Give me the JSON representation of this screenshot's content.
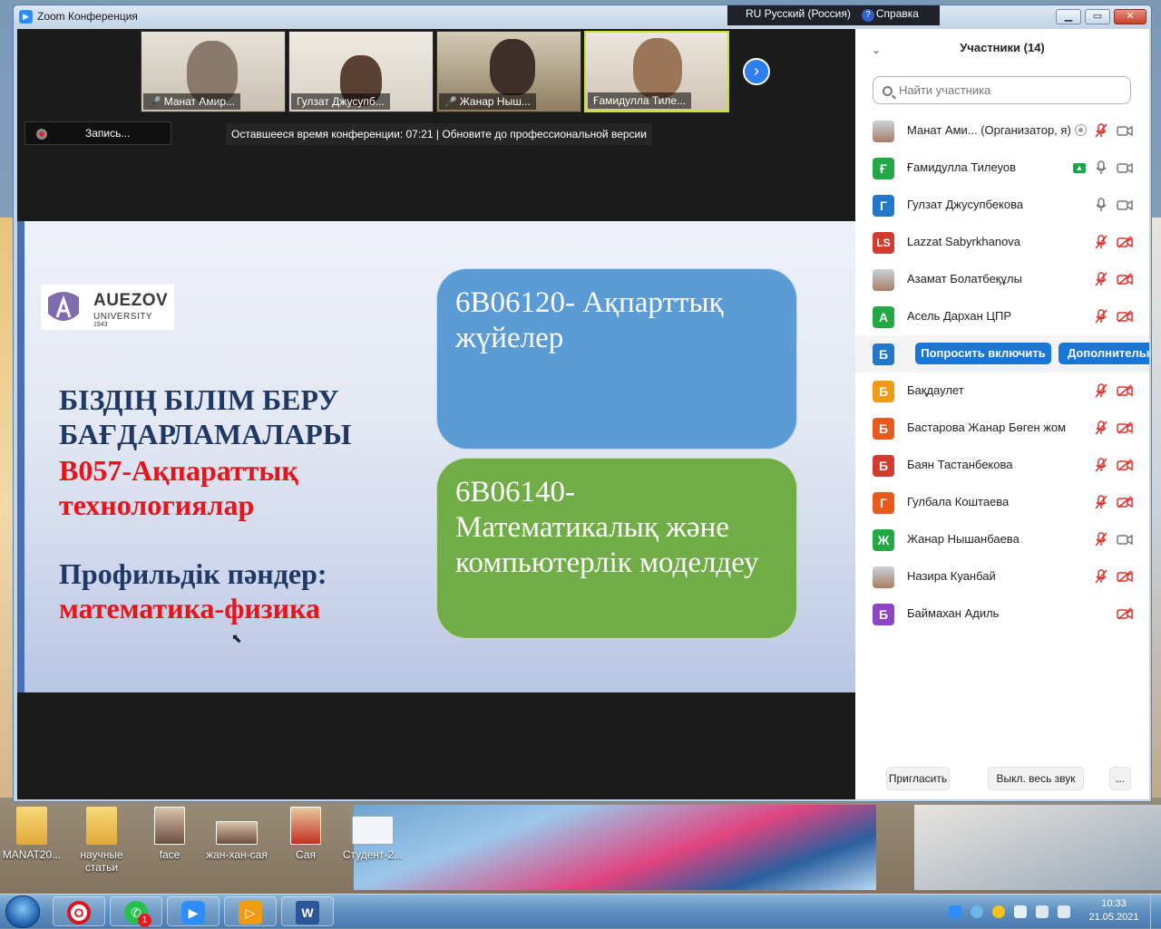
{
  "window": {
    "title": "Zoom Конференция",
    "language": "RU Русский (Россия)",
    "help": "Справка"
  },
  "video_strip": [
    {
      "name": "Манат Амир...",
      "muted": true
    },
    {
      "name": "Гулзат Джусупб...",
      "muted": false
    },
    {
      "name": "Жанар Ныш...",
      "muted": true
    },
    {
      "name": "Ғамидулла Тиле...",
      "muted": false,
      "active": true
    }
  ],
  "recording_label": "Запись...",
  "time_notice": "Оставшееся время конференции: 07:21 | Обновите до профессиональной версии",
  "slide": {
    "logo_name": "AUEZOV",
    "logo_university": "UNIVERSITY",
    "logo_year": "1943",
    "heading_line1": "БІЗДІҢ БІЛІМ БЕРУ",
    "heading_line2": "БАҒДАРЛАМАЛАРЫ",
    "group_line1": "В057-Ақпараттық",
    "group_line2": "технологиялар",
    "profile_label": "Профильдік пәндер:",
    "profile_value": "математика-физика",
    "program1": "6В06120- Ақпарттық жүйелер",
    "program2": "6В06140- Математикалық және компьютерлік моделдеу"
  },
  "panel": {
    "title": "Участники (14)",
    "search_placeholder": "Найти участника",
    "participants": [
      {
        "name": "Манат Ами... (Организатор, я)",
        "initial": "",
        "color": "",
        "photo": true,
        "mic": "muted",
        "cam": "on",
        "host": true
      },
      {
        "name": "Ғамидулла Тилеуов",
        "initial": "Ғ",
        "color": "#22a844",
        "mic": "on",
        "cam": "on",
        "sharing": true
      },
      {
        "name": "Гулзат Джусупбекова",
        "initial": "Г",
        "color": "#2277c9",
        "mic": "on",
        "cam": "on"
      },
      {
        "name": "Lazzat Sabyrkhanova",
        "initial": "LS",
        "color": "#d23b2e",
        "mic": "muted",
        "cam": "off"
      },
      {
        "name": "Азамат Болатбеқұлы",
        "initial": "",
        "color": "",
        "photo": true,
        "mic": "muted",
        "cam": "off"
      },
      {
        "name": "Асель Дархан ЦПР",
        "initial": "А",
        "color": "#22a844",
        "mic": "muted",
        "cam": "off"
      },
      {
        "name": "",
        "initial": "Б",
        "color": "#2277c9",
        "hover": true
      },
      {
        "name": "Бақдаулет",
        "initial": "Б",
        "color": "#f29a13",
        "mic": "muted",
        "cam": "off"
      },
      {
        "name": "Бастарова Жанар Бөген жом",
        "initial": "Б",
        "color": "#e85a1c",
        "mic": "muted",
        "cam": "off"
      },
      {
        "name": "Баян Тастанбекова",
        "initial": "Б",
        "color": "#d23b2e",
        "mic": "muted",
        "cam": "off"
      },
      {
        "name": "Гулбала Коштаева",
        "initial": "Г",
        "color": "#e85a1c",
        "mic": "muted",
        "cam": "off"
      },
      {
        "name": "Жанар Нышанбаева",
        "initial": "Ж",
        "color": "#22a844",
        "mic": "muted",
        "cam": "on"
      },
      {
        "name": "Назира Куанбай",
        "initial": "",
        "color": "",
        "photo": true,
        "mic": "muted",
        "cam": "off"
      },
      {
        "name": "Баймахан Адиль",
        "initial": "Б",
        "color": "#8e44c4",
        "mic": "none",
        "cam": "off"
      }
    ],
    "ask_unmute": "Попросить включить",
    "more": "Дополнительно",
    "invite": "Пригласить",
    "mute_all": "Выкл. весь звук",
    "ellipsis": "..."
  },
  "desktop_icons": [
    {
      "label": "MANAT20..."
    },
    {
      "label": "научные статьи"
    },
    {
      "label": "face"
    },
    {
      "label": "жан-хан-сая"
    },
    {
      "label": "Сая"
    },
    {
      "label": "Студент-2..."
    }
  ],
  "taskbar": {
    "whatsapp_badge": "1",
    "time": "10:33",
    "date": "21.05.2021"
  }
}
